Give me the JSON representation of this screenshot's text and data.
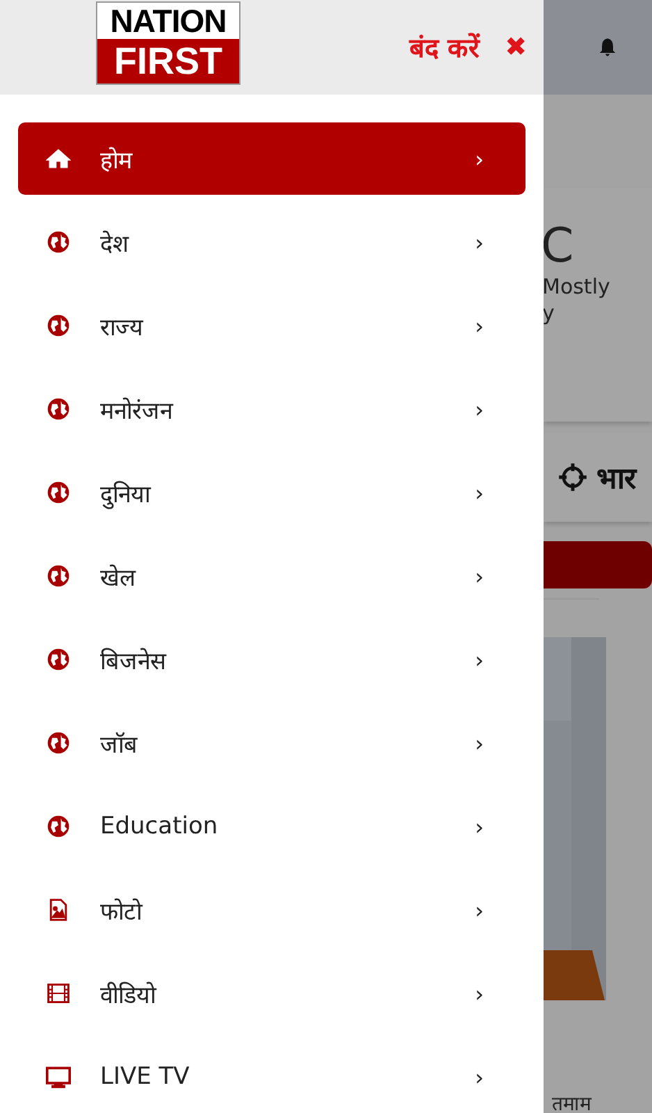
{
  "drawer": {
    "logo": {
      "line_1": "NATION",
      "line_2": "FIRST"
    },
    "close_label": "बंद करें",
    "close_icon": "✖",
    "items": [
      {
        "label": "होम",
        "kind": "home",
        "selected": true,
        "chevron": "›"
      },
      {
        "label": "देश",
        "kind": "globe",
        "selected": false,
        "chevron": "›"
      },
      {
        "label": "राज्य",
        "kind": "globe",
        "selected": false,
        "chevron": "›"
      },
      {
        "label": "मनोरंजन",
        "kind": "globe",
        "selected": false,
        "chevron": "›"
      },
      {
        "label": "दुनिया",
        "kind": "globe",
        "selected": false,
        "chevron": "›"
      },
      {
        "label": "खेल",
        "kind": "globe",
        "selected": false,
        "chevron": "›"
      },
      {
        "label": "बिजनेस",
        "kind": "globe",
        "selected": false,
        "chevron": "›"
      },
      {
        "label": "जॉब",
        "kind": "globe",
        "selected": false,
        "chevron": "›"
      },
      {
        "label": "Education",
        "kind": "globe",
        "selected": false,
        "chevron": "›"
      },
      {
        "label": "फोटो",
        "selected": false,
        "chevron": "›"
      },
      {
        "label": "वीडियो",
        "kind": "video",
        "selected": false,
        "chevron": "›"
      },
      {
        "label": "LIVE TV",
        "kind": "tv",
        "selected": false,
        "chevron": "›"
      }
    ]
  },
  "background": {
    "weather_temp": "C",
    "weather_text_1": "Mostly",
    "weather_text_2": "y",
    "location_text": "भार",
    "headline_fragment": "तमाम"
  }
}
